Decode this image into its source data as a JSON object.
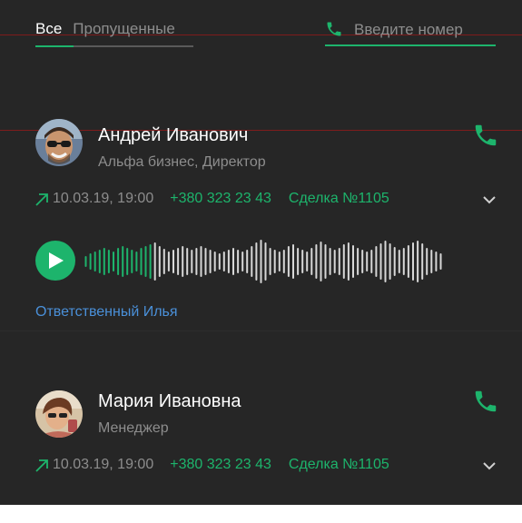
{
  "tabs": [
    {
      "label": "Все",
      "active": true
    },
    {
      "label": "Пропущенные",
      "active": false
    }
  ],
  "search": {
    "placeholder": "Введите номер",
    "value": ""
  },
  "calls": [
    {
      "name": "Андрей Иванович",
      "subtitle": "Альфа бизнес, Директор",
      "datetime": "10.03.19, 19:00",
      "phone": "+380 323 23 43",
      "deal": "Сделка №1105",
      "direction": "outgoing",
      "responsible": "Ответственный Илья",
      "recording": {
        "played_fraction": 0.19
      }
    },
    {
      "name": "Мария Ивановна",
      "subtitle": "Менеджер",
      "datetime": "10.03.19, 19:00",
      "phone": "+380 323 23 43",
      "deal": "Сделка №1105",
      "direction": "outgoing"
    }
  ],
  "colors": {
    "accent": "#1db46c",
    "background": "#262626",
    "text_primary": "#ffffff",
    "text_secondary": "#8d8d8d",
    "link": "#4a90d9"
  },
  "icons": {
    "call": "phone-icon",
    "direction": "arrow-up-right-icon",
    "expand": "chevron-down-icon",
    "play": "play-icon"
  }
}
